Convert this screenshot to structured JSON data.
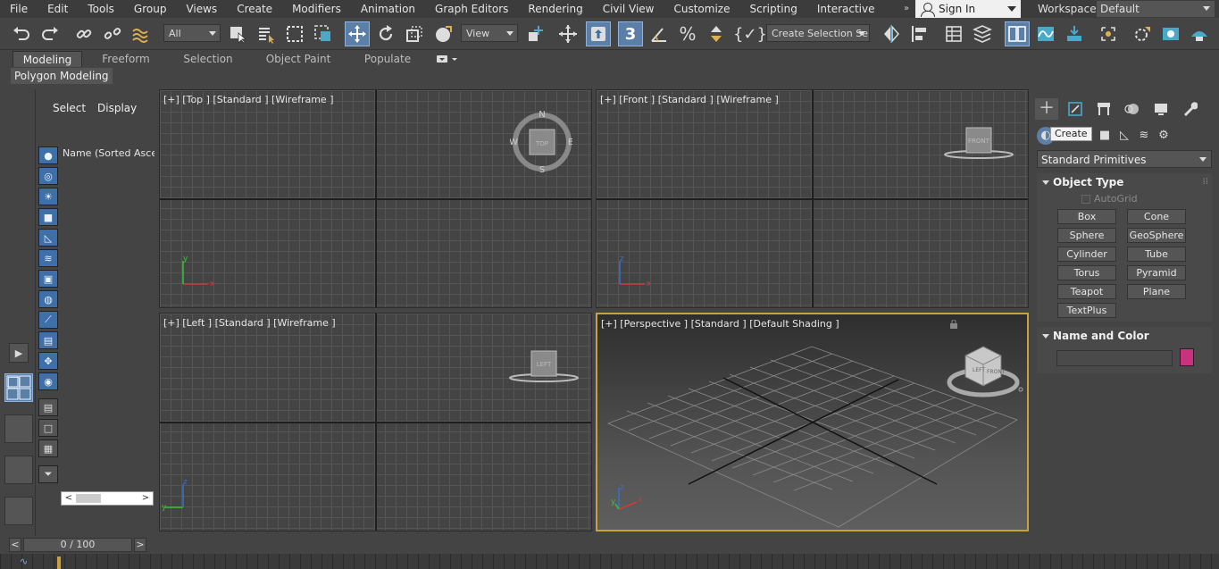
{
  "menu": [
    "File",
    "Edit",
    "Tools",
    "Group",
    "Views",
    "Create",
    "Modifiers",
    "Animation",
    "Graph Editors",
    "Rendering",
    "Civil View",
    "Customize",
    "Scripting",
    "Interactive"
  ],
  "menu_overflow": "»",
  "signin": "Sign In",
  "workspaces": {
    "label": "Workspaces:",
    "value": "Default"
  },
  "toolbar": {
    "selection_filter": "All",
    "reference_coord": "View",
    "selection_set": "Create Selection Se"
  },
  "ribbon": {
    "tabs": [
      "Modeling",
      "Freeform",
      "Selection",
      "Object Paint",
      "Populate"
    ],
    "active": "Modeling",
    "panel": "Polygon Modeling"
  },
  "explorer": {
    "tabs": [
      "Select",
      "Display"
    ],
    "column": "Name (Sorted Ascenc"
  },
  "viewports": {
    "top": "[+] [Top ] [Standard ] [Wireframe ]",
    "front": "[+] [Front ] [Standard ] [Wireframe ]",
    "left": "[+] [Left ] [Standard ] [Wireframe ]",
    "perspective": "[+] [Perspective ] [Standard ] [Default Shading ]"
  },
  "compass": {
    "n": "N",
    "s": "S",
    "e": "E",
    "w": "W"
  },
  "navcube": {
    "top": "TOP",
    "front": "FRONT",
    "left": "LEFT",
    "persp_left": "LEFT",
    "persp_front": "FRONT"
  },
  "axes": {
    "x": "x",
    "y": "y",
    "z": "z"
  },
  "command_panel": {
    "tooltip": "Create",
    "category": "Standard Primitives",
    "object_type": {
      "title": "Object Type",
      "autogrid": "AutoGrid",
      "buttons": [
        "Box",
        "Cone",
        "Sphere",
        "GeoSphere",
        "Cylinder",
        "Tube",
        "Torus",
        "Pyramid",
        "Teapot",
        "Plane",
        "TextPlus"
      ]
    },
    "name_color": {
      "title": "Name and Color",
      "name_value": "",
      "color": "#c8327f"
    }
  },
  "timeline": {
    "frame": "0 / 100",
    "prev": "<",
    "next": ">"
  }
}
